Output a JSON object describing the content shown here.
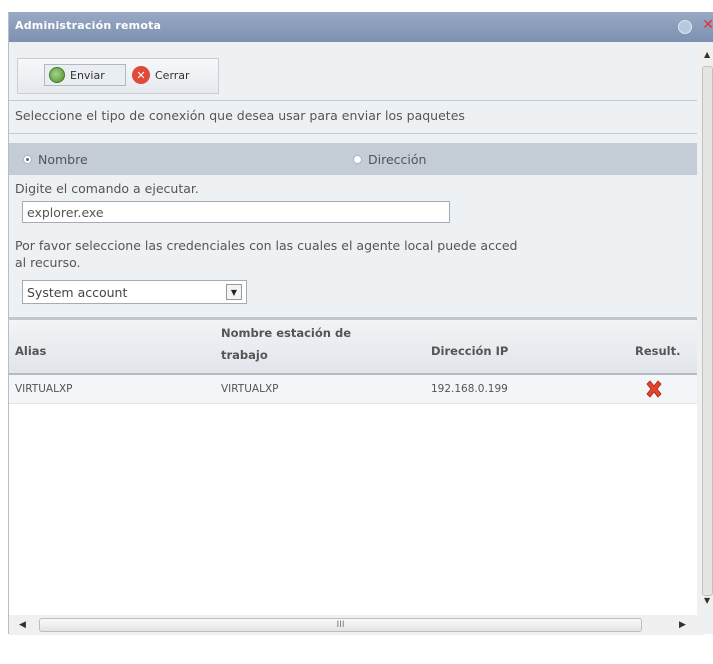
{
  "window": {
    "title": "Administración remota"
  },
  "toolbar": {
    "send_label": "Enviar",
    "close_label": "Cerrar"
  },
  "connection": {
    "prompt": "Seleccione el tipo de conexión que desea usar para enviar los paquetes",
    "options": [
      {
        "label": "Nombre",
        "selected": true
      },
      {
        "label": "Dirección",
        "selected": false
      }
    ]
  },
  "command": {
    "label": "Digite el comando a ejecutar.",
    "value": "explorer.exe"
  },
  "credentials": {
    "label_line1": "Por favor seleccione las credenciales con las cuales el agente local puede acced",
    "label_line2": "al recurso.",
    "selected": "System account"
  },
  "table": {
    "columns": [
      "Alias",
      "Nombre estación de",
      "trabajo",
      "Dirección IP",
      "Result."
    ],
    "rows": [
      {
        "alias": "VIRTUALXP",
        "workstation": "VIRTUALXP",
        "ip": "192.168.0.199",
        "result_icon": "fail-x-icon"
      }
    ]
  },
  "scrollbar": {
    "grip": "III"
  },
  "colors": {
    "titlebar": "#8a9dbb",
    "radio_band": "#c4ccd6",
    "fail": "#e2452c"
  }
}
